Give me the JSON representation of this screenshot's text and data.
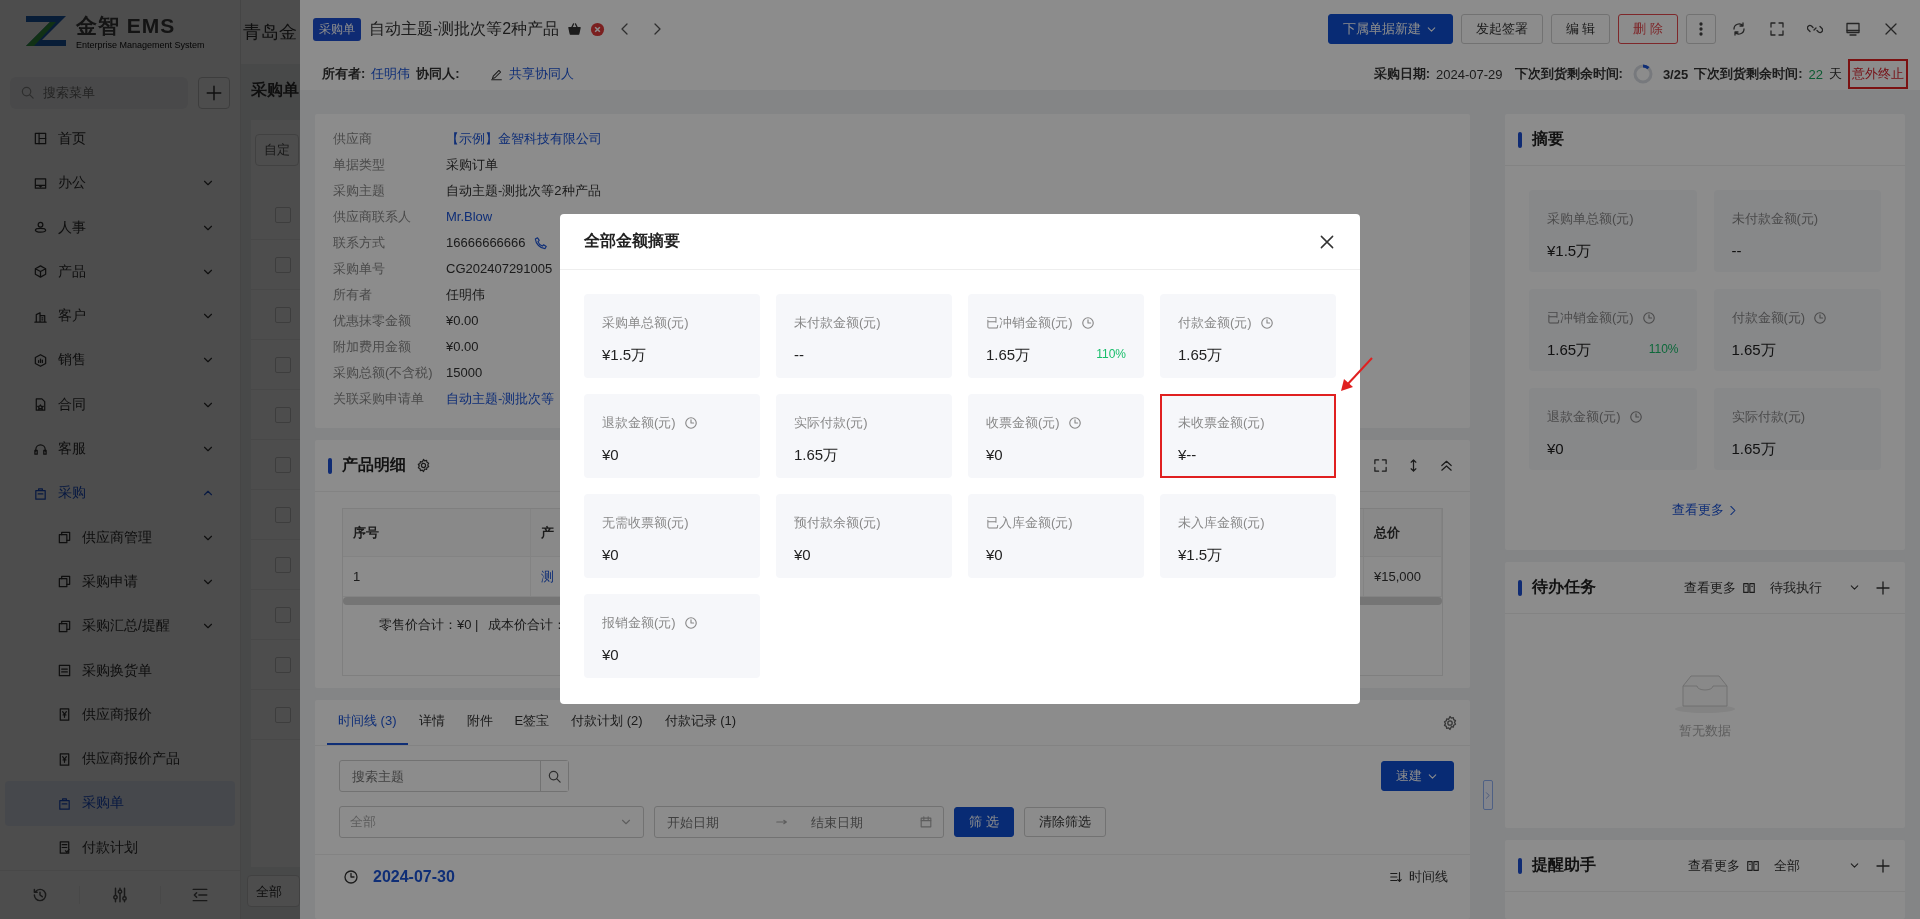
{
  "sidebar": {
    "brand": "金智 EMS",
    "tagline": "Enterprise Management System",
    "search": {
      "placeholder": "搜索菜单"
    },
    "items": [
      {
        "label": "首页",
        "selected": false
      },
      {
        "label": "办公",
        "selected": false,
        "expanded": false
      },
      {
        "label": "人事",
        "selected": false,
        "expanded": false
      },
      {
        "label": "产品",
        "selected": false,
        "expanded": false
      },
      {
        "label": "客户",
        "selected": false,
        "expanded": false
      },
      {
        "label": "销售",
        "selected": false,
        "expanded": false
      },
      {
        "label": "合同",
        "selected": false,
        "expanded": false
      },
      {
        "label": "客服",
        "selected": false,
        "expanded": false
      },
      {
        "label": "采购",
        "selected": true,
        "expanded": true,
        "children": [
          {
            "label": "供应商管理",
            "selected": false,
            "expanded": false
          },
          {
            "label": "采购申请",
            "selected": false,
            "expanded": false
          },
          {
            "label": "采购汇总/提醒",
            "selected": false,
            "expanded": false
          },
          {
            "label": "采购换货单",
            "selected": false
          },
          {
            "label": "供应商报价",
            "selected": false
          },
          {
            "label": "供应商报价产品",
            "selected": false
          },
          {
            "label": "采购单",
            "selected": true
          },
          {
            "label": "付款计划",
            "selected": false
          }
        ]
      }
    ]
  },
  "background_page": {
    "company": "青岛金",
    "title": "采购单",
    "filter": "自定",
    "rows": [
      {
        "checked": false
      },
      {
        "checked": false
      },
      {
        "checked": false
      },
      {
        "checked": false
      },
      {
        "checked": false
      },
      {
        "checked": false
      },
      {
        "checked": false
      },
      {
        "checked": false
      },
      {
        "checked": false
      },
      {
        "checked": false
      },
      {
        "checked": false
      }
    ],
    "scope": "全部"
  },
  "drawer": {
    "badge": "采购单",
    "title": "自动主题-测批次等2种产品",
    "actions": [
      {
        "label": "下属单据新建",
        "kind": "primary"
      },
      {
        "label": "发起签署",
        "kind": "default"
      },
      {
        "label": "编 辑",
        "kind": "default"
      },
      {
        "label": "删 除",
        "kind": "danger"
      }
    ],
    "meta": {
      "owner_label": "所有者:",
      "owner": "任明伟",
      "collaborator_label": "协同人:",
      "share": "共享协同人",
      "date_label": "采购日期:",
      "date": "2024-07-29",
      "arrival_label": "下次到货剩余时间:",
      "arrival": {
        "level": 0.12,
        "text": "3/25"
      },
      "remaining_label": "下次到货剩余时间:",
      "remaining_days": "22",
      "days_unit": "天",
      "terminate": "意外终止"
    },
    "info": {
      "fields": [
        {
          "label": "供应商",
          "value": "【示例】金智科技有限公司",
          "kind": "link"
        },
        {
          "label": "单据类型",
          "value": "采购订单",
          "kind": "text"
        },
        {
          "label": "采购主题",
          "value": "自动主题-测批次等2种产品",
          "kind": "text"
        },
        {
          "label": "供应商联系人",
          "value": "Mr.Blow",
          "kind": "link"
        },
        {
          "label": "联系方式",
          "value": "16666666666",
          "kind": "phone"
        },
        {
          "label": "采购单号",
          "value": "CG202407291005",
          "kind": "text"
        },
        {
          "label": "所有者",
          "value": "任明伟",
          "kind": "text"
        },
        {
          "label": "优惠抹零金额",
          "value": "¥0.00",
          "kind": "text"
        },
        {
          "label": "附加费用金额",
          "value": "¥0.00",
          "kind": "text"
        },
        {
          "label": "采购总额(不含税)",
          "value": "15000",
          "kind": "text"
        },
        {
          "label": "关联采购申请单",
          "value": "自动主题-测批次等",
          "kind": "link"
        }
      ]
    },
    "products": {
      "title": "产品明细",
      "columns": [
        "序号",
        "产",
        "总价"
      ],
      "rows": [
        {
          "cells": [
            "1",
            "测",
            "¥15,000"
          ]
        }
      ],
      "totals": [
        "零售价合计：¥0 |",
        "成本价合计："
      ]
    },
    "activity": {
      "tabs": [
        {
          "label": "时间线 (3)",
          "selected": true
        },
        {
          "label": "详情",
          "selected": false
        },
        {
          "label": "附件",
          "selected": false
        },
        {
          "label": "E签宝",
          "selected": false
        },
        {
          "label": "付款计划 (2)",
          "selected": false
        },
        {
          "label": "付款记录 (1)",
          "selected": false
        }
      ],
      "search": {
        "placeholder": "搜索主题"
      },
      "quick_create": "速建",
      "type_filter": "全部",
      "start_date": {
        "placeholder": "开始日期"
      },
      "end_date": {
        "placeholder": "结束日期"
      },
      "filter_button": "筛 选",
      "clear_button": "清除筛选",
      "entries": [
        {
          "date": "2024-07-30"
        }
      ],
      "view": "时间线"
    },
    "summary": {
      "title": "摘要",
      "cards": [
        {
          "label": "采购单总额(元)",
          "value": "¥1.5万",
          "history": false
        },
        {
          "label": "未付款金额(元)",
          "value": "--",
          "history": false
        },
        {
          "label": "已冲销金额(元)",
          "value": "1.65万",
          "history": true,
          "percent": "110%"
        },
        {
          "label": "付款金额(元)",
          "value": "1.65万",
          "history": true
        },
        {
          "label": "退款金额(元)",
          "value": "¥0",
          "history": true
        },
        {
          "label": "实际付款(元)",
          "value": "1.65万",
          "history": false
        }
      ],
      "more": "查看更多"
    },
    "tasks": {
      "title": "待办任务",
      "more": "查看更多",
      "filter": "待我执行",
      "empty": "暂无数据"
    },
    "reminders": {
      "title": "提醒助手",
      "more": "查看更多",
      "filter": "全部"
    }
  },
  "modal": {
    "title": "全部金额摘要",
    "cards": [
      {
        "label": "采购单总额(元)",
        "value": "¥1.5万",
        "history": false,
        "highlighted": false
      },
      {
        "label": "未付款金额(元)",
        "value": "--",
        "history": false,
        "highlighted": false
      },
      {
        "label": "已冲销金额(元)",
        "value": "1.65万",
        "history": true,
        "percent": "110%",
        "highlighted": false
      },
      {
        "label": "付款金额(元)",
        "value": "1.65万",
        "history": true,
        "highlighted": false
      },
      {
        "label": "退款金额(元)",
        "value": "¥0",
        "history": true,
        "highlighted": false
      },
      {
        "label": "实际付款(元)",
        "value": "1.65万",
        "history": false,
        "highlighted": false
      },
      {
        "label": "收票金额(元)",
        "value": "¥0",
        "history": true,
        "highlighted": false
      },
      {
        "label": "未收票金额(元)",
        "value": "¥--",
        "history": false,
        "highlighted": true
      },
      {
        "label": "无需收票额(元)",
        "value": "¥0",
        "history": false,
        "highlighted": false
      },
      {
        "label": "预付款余额(元)",
        "value": "¥0",
        "history": false,
        "highlighted": false
      },
      {
        "label": "已入库金额(元)",
        "value": "¥0",
        "history": false,
        "highlighted": false
      },
      {
        "label": "未入库金额(元)",
        "value": "¥1.5万",
        "history": false,
        "highlighted": false
      },
      {
        "label": "报销金额(元)",
        "value": "¥0",
        "history": true,
        "highlighted": false
      }
    ]
  }
}
